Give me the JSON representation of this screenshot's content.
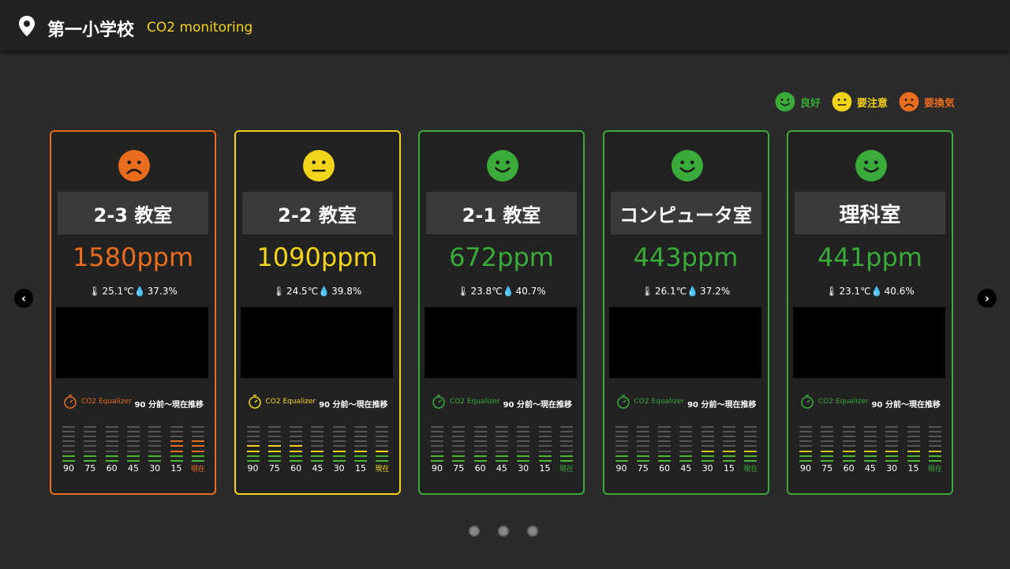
{
  "header": {
    "school_name": "第一小学校",
    "app_label": "CO2 monitoring"
  },
  "legend": [
    {
      "label": "良好",
      "status": "good",
      "color": "#3aab3a"
    },
    {
      "label": "要注意",
      "status": "caution",
      "color": "#f2d41a"
    },
    {
      "label": "要換気",
      "status": "ventilate",
      "color": "#e96c1f"
    }
  ],
  "rooms": [
    {
      "name": "2-3 教室",
      "ppm": "1580ppm",
      "temp": "25.1℃",
      "humidity": "37.3%",
      "status": "ventilate",
      "color": "#e96c1f",
      "equalizer_label": "CO2 Equalizer",
      "trend_label": "90 分前〜現在推移",
      "bars": [
        2,
        2,
        2,
        2,
        2,
        5,
        5
      ],
      "bar_colors": [
        "#4cb82e",
        "#4cb82e",
        "#4cb82e",
        "#4cb82e",
        "#4cb82e",
        "#e96c1f",
        "#e96c1f"
      ]
    },
    {
      "name": "2-2 教室",
      "ppm": "1090ppm",
      "temp": "24.5℃",
      "humidity": "39.8%",
      "status": "caution",
      "color": "#f2d41a",
      "equalizer_label": "CO2 Equalizer",
      "trend_label": "90 分前〜現在推移",
      "bars": [
        4,
        4,
        4,
        3,
        3,
        3,
        3
      ],
      "bar_colors": [
        "#f2d41a",
        "#f2d41a",
        "#f2d41a",
        "#f2d41a",
        "#f2d41a",
        "#f2d41a",
        "#f2d41a"
      ]
    },
    {
      "name": "2-1 教室",
      "ppm": "672ppm",
      "temp": "23.8℃",
      "humidity": "40.7%",
      "status": "good",
      "color": "#3aab3a",
      "equalizer_label": "CO2 Equalizer",
      "trend_label": "90 分前〜現在推移",
      "bars": [
        2,
        2,
        2,
        2,
        2,
        2,
        2
      ],
      "bar_colors": [
        "#4cb82e",
        "#4cb82e",
        "#4cb82e",
        "#4cb82e",
        "#4cb82e",
        "#4cb82e",
        "#4cb82e"
      ]
    },
    {
      "name": "コンピュータ室",
      "ppm": "443ppm",
      "temp": "26.1℃",
      "humidity": "37.2%",
      "status": "good",
      "color": "#3aab3a",
      "equalizer_label": "CO2 Equalizer",
      "trend_label": "90 分前〜現在推移",
      "bars": [
        2,
        2,
        2,
        2,
        3,
        3,
        3
      ],
      "bar_colors": [
        "#4cb82e",
        "#4cb82e",
        "#4cb82e",
        "#4cb82e",
        "#c8c91a",
        "#c8c91a",
        "#c8c91a"
      ]
    },
    {
      "name": "理科室",
      "ppm": "441ppm",
      "temp": "23.1℃",
      "humidity": "40.6%",
      "status": "good",
      "color": "#3aab3a",
      "equalizer_label": "CO2 Equalizer",
      "trend_label": "90 分前〜現在推移",
      "bars": [
        3,
        3,
        3,
        3,
        3,
        3,
        3
      ],
      "bar_colors": [
        "#c8c91a",
        "#c8c91a",
        "#c8c91a",
        "#c8c91a",
        "#c8c91a",
        "#c8c91a",
        "#c8c91a"
      ]
    }
  ],
  "time_ticks": [
    "90",
    "75",
    "60",
    "45",
    "30",
    "15",
    "現在"
  ],
  "nav": {
    "prev": "‹",
    "next": "›"
  },
  "pagination": {
    "pages": 3,
    "current": 1
  }
}
